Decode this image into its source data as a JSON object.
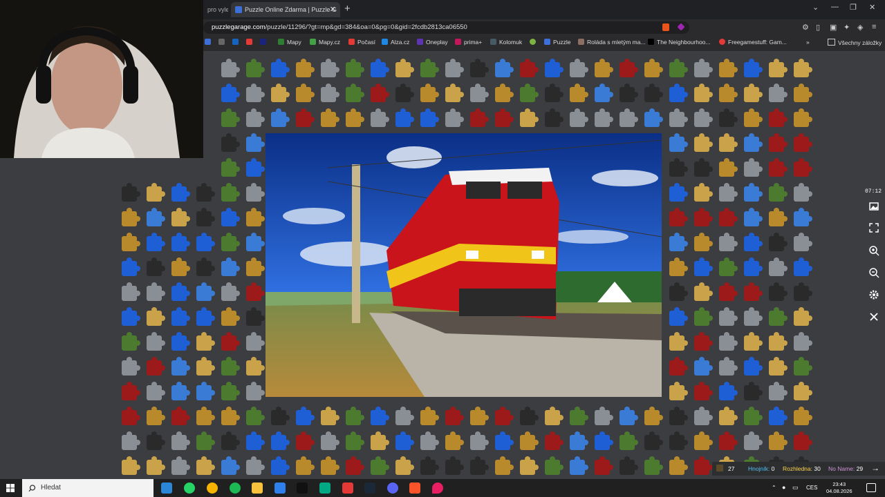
{
  "browser": {
    "prev_tab_label": "pro vyle",
    "active_tab_label": "Puzzle Online Zdarma | Puzzle G",
    "new_tab": "+",
    "close_tab": "✕",
    "url_domain": "puzzlegarage.com",
    "url_path": "/puzzle/11296/?gt=mp&gd=384&oa=0&pg=0&gid=2fcdb2813ca06550",
    "window_controls": [
      "⌄",
      "—",
      "❐",
      "✕"
    ],
    "menu": "≡"
  },
  "bookmarks": {
    "items": [
      {
        "label": "Mapy",
        "color": "#2e7d32"
      },
      {
        "label": "Mapy.cz",
        "color": "#43a047"
      },
      {
        "label": "Počasí",
        "color": "#e53935"
      },
      {
        "label": "Alza.cz",
        "color": "#1e88e5"
      },
      {
        "label": "Oneplay",
        "color": "#5e35b1"
      },
      {
        "label": "prima+",
        "color": "#c2185b"
      },
      {
        "label": "Kolomuk",
        "color": "#455a64"
      },
      {
        "label": "",
        "color": "#7cb342"
      },
      {
        "label": "Puzzle",
        "color": "#3d6fd8"
      },
      {
        "label": "Roláda s mletým ma...",
        "color": "#8d6e63"
      },
      {
        "label": "The Neighbourhoo...",
        "color": "#000000"
      },
      {
        "label": "Freegamestuff: Gam...",
        "color": "#e53935"
      }
    ],
    "overflow": "»",
    "all_bookmarks": "Všechny záložky"
  },
  "game": {
    "timer": "07:12",
    "scores": [
      {
        "name": "",
        "value": "27",
        "color": "#ffffff"
      },
      {
        "name": "Hnojník:",
        "value": "0",
        "color": "#4fc3f7"
      },
      {
        "name": "Rozhledna:",
        "value": "30",
        "color": "#ffd54f"
      },
      {
        "name": "No Name:",
        "value": "29",
        "color": "#ce93d8"
      }
    ],
    "next_arrow": "→"
  },
  "taskbar": {
    "search_placeholder": "Hledat",
    "language": "CES",
    "time": "23:43",
    "date": "04.08.2026"
  },
  "colors": {
    "bg": "#3b3d41",
    "piece_blue": "#1f5fd6",
    "piece_gold": "#b98a2b",
    "train_red": "#c8141a",
    "train_yellow": "#f0c419"
  }
}
